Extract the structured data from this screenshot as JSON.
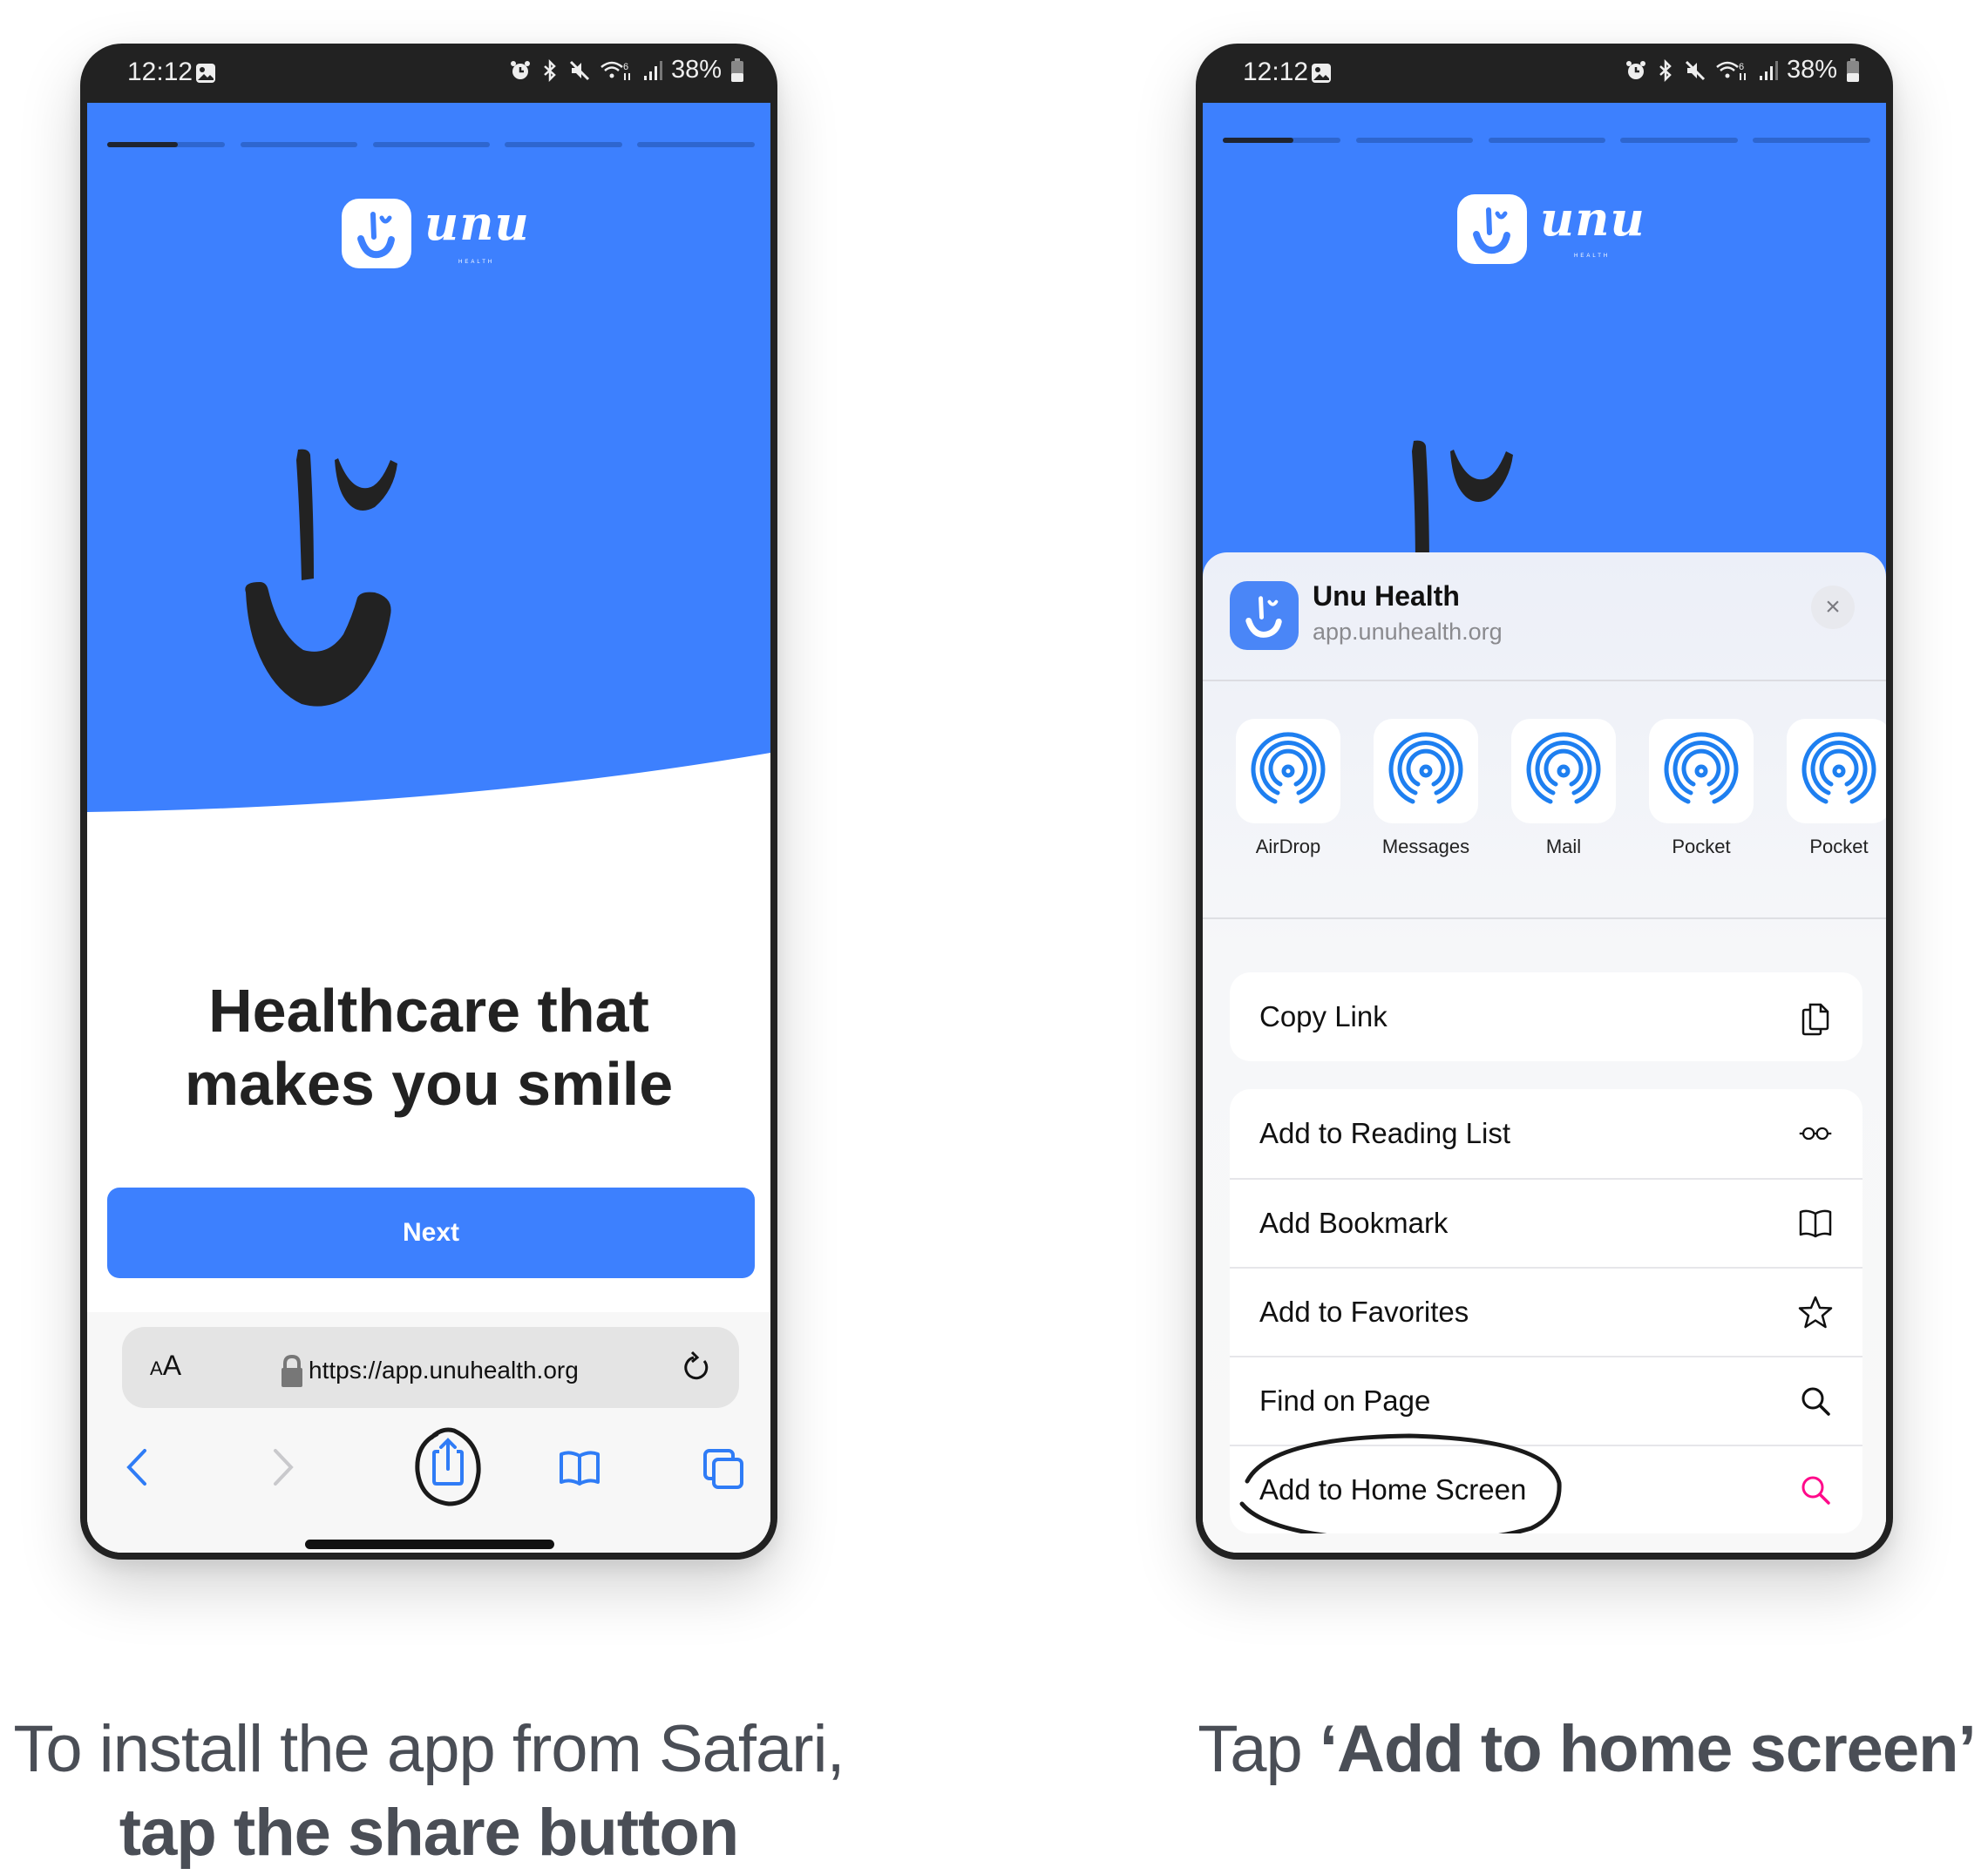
{
  "status_bar": {
    "time": "12:12",
    "battery": "38%",
    "icons": [
      "gallery-icon",
      "alarm-icon",
      "bluetooth-icon",
      "mute-icon",
      "wifi-icon",
      "signal-icon",
      "battery-icon"
    ]
  },
  "onboarding": {
    "progress": {
      "segments": 5,
      "current_segment": 1,
      "current_fill": 0.6
    },
    "logo_word": "unu",
    "logo_sub": "HEALTH",
    "heading_line1": "Healthcare that",
    "heading_line2": "makes you smile",
    "next_label": "Next"
  },
  "safari": {
    "aa_label": "AA",
    "url": "https://app.unuhealth.org",
    "toolbar_icons": [
      "back-icon",
      "forward-icon",
      "share-icon",
      "bookmarks-icon",
      "tabs-icon"
    ]
  },
  "share_sheet": {
    "title": "Unu Health",
    "subtitle": "app.unuhealth.org",
    "close_label": "×",
    "apps": [
      {
        "label": "AirDrop"
      },
      {
        "label": "Messages"
      },
      {
        "label": "Mail"
      },
      {
        "label": "Pocket"
      },
      {
        "label": "Pocket"
      }
    ],
    "copy_link": {
      "label": "Copy Link",
      "icon": "copy-icon"
    },
    "actions": [
      {
        "label": "Add to Reading List",
        "icon": "glasses-icon"
      },
      {
        "label": "Add Bookmark",
        "icon": "book-icon"
      },
      {
        "label": "Add to Favorites",
        "icon": "star-icon"
      },
      {
        "label": "Find on Page",
        "icon": "search-icon"
      },
      {
        "label": "Add to Home Screen",
        "icon": "search-icon",
        "highlight_color": "#ff0a8a"
      }
    ]
  },
  "captions": {
    "left_line1": "To install the app from Safari,",
    "left_line2": "tap the share button",
    "right_prefix": "Tap ",
    "right_bold": "‘Add to home screen’"
  },
  "colors": {
    "brand_blue": "#3d80fe",
    "ios_blue": "#2f7cf6",
    "highlight_pink": "#ff0a8a",
    "caption_gray": "#4a4e56"
  }
}
